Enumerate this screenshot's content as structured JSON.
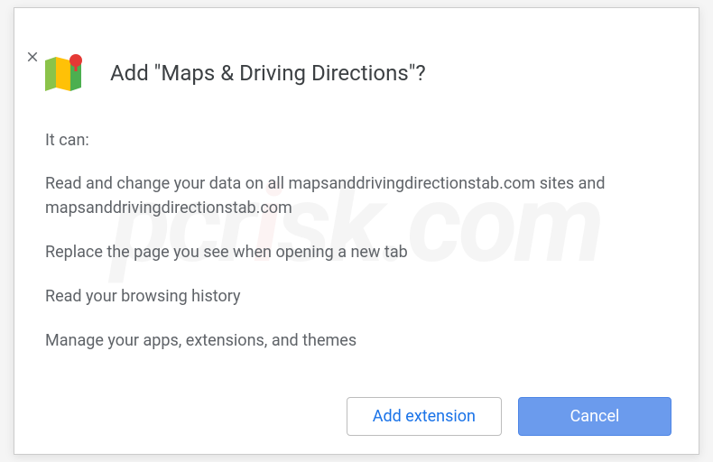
{
  "dialog": {
    "title": "Add \"Maps & Driving Directions\"?",
    "intro": "It can:",
    "permissions": [
      "Read and change your data on all mapsanddrivingdirectionstab.com sites and mapsanddrivingdirectionstab.com",
      "Replace the page you see when opening a new tab",
      "Read your browsing history",
      "Manage your apps, extensions, and themes"
    ],
    "buttons": {
      "add": "Add extension",
      "cancel": "Cancel"
    }
  },
  "watermark": {
    "pre": "pcr",
    "i": "i",
    "post": "sk.com"
  }
}
